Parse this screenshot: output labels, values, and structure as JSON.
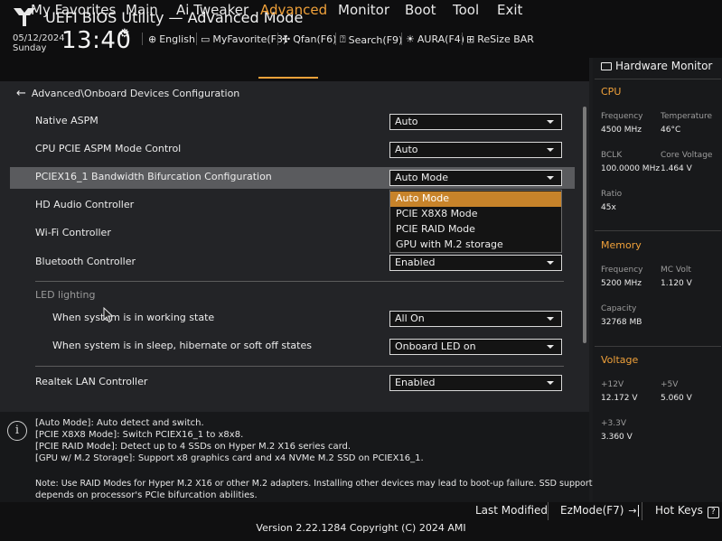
{
  "app": {
    "title": "UEFI BIOS Utility — Advanced Mode"
  },
  "clock": {
    "date": "05/12/2024",
    "day": "Sunday",
    "time": "13:40"
  },
  "toolbar": {
    "items": [
      {
        "label": "English",
        "icon": "globe-icon"
      },
      {
        "label": "MyFavorite(F3)",
        "icon": "favorite-icon"
      },
      {
        "label": "Qfan(F6)",
        "icon": "fan-icon"
      },
      {
        "label": "Search(F9)",
        "icon": "search-icon"
      },
      {
        "label": "AURA(F4)",
        "icon": "aura-icon"
      },
      {
        "label": "ReSize BAR",
        "icon": "resize-bar-icon"
      }
    ]
  },
  "menu": {
    "items": [
      "My Favorites",
      "Main",
      "Ai Tweaker",
      "Advanced",
      "Monitor",
      "Boot",
      "Tool",
      "Exit"
    ],
    "active": "Advanced"
  },
  "breadcrumb": "Advanced\\Onboard Devices Configuration",
  "settings": [
    {
      "label": "Native ASPM",
      "value": "Auto"
    },
    {
      "label": "CPU PCIE ASPM Mode Control",
      "value": "Auto"
    },
    {
      "label": "PCIEX16_1 Bandwidth Bifurcation Configuration",
      "value": "Auto Mode"
    },
    {
      "label": "HD Audio Controller",
      "value": ""
    },
    {
      "label": "Wi-Fi Controller",
      "value": ""
    },
    {
      "label": "Bluetooth Controller",
      "value": "Enabled"
    },
    {
      "label": "LED lighting",
      "value": ""
    },
    {
      "label": "When system is in working state",
      "value": "All On"
    },
    {
      "label": "When system is in sleep, hibernate or soft off states",
      "value": "Onboard LED on"
    },
    {
      "label": "Realtek LAN Controller",
      "value": "Enabled"
    }
  ],
  "dropdown": {
    "options": [
      "Auto Mode",
      "PCIE X8X8 Mode",
      "PCIE RAID Mode",
      "GPU with M.2 storage"
    ],
    "selected": "Auto Mode"
  },
  "help": {
    "lines": [
      "[Auto Mode]: Auto detect and switch.",
      "[PCIE X8X8 Mode]: Switch PCIEX16_1 to x8x8.",
      "[PCIE RAID Mode]: Detect up to 4 SSDs on Hyper M.2 X16 series card.",
      "[GPU w/ M.2 Storage]: Support x8 graphics card and x4 NVMe M.2 SSD on PCIEX16_1.",
      "Note: Use RAID Modes for Hyper M.2 X16 or other M.2 adapters. Installing other devices may lead to boot-up failure. SSD support",
      "depends on processor's PCIe bifurcation abilities."
    ]
  },
  "hardware_monitor": {
    "title": "Hardware Monitor",
    "cpu": {
      "heading": "CPU",
      "frequency_label": "Frequency",
      "frequency": "4500 MHz",
      "temperature_label": "Temperature",
      "temperature": "46°C",
      "bclk_label": "BCLK",
      "bclk": "100.0000 MHz",
      "core_voltage_label": "Core Voltage",
      "core_voltage": "1.464 V",
      "ratio_label": "Ratio",
      "ratio": "45x"
    },
    "memory": {
      "heading": "Memory",
      "frequency_label": "Frequency",
      "frequency": "5200 MHz",
      "mc_volt_label": "MC Volt",
      "mc_volt": "1.120 V",
      "capacity_label": "Capacity",
      "capacity": "32768 MB"
    },
    "voltage": {
      "heading": "Voltage",
      "v12_label": "+12V",
      "v12": "12.172 V",
      "v5_label": "+5V",
      "v5": "5.060 V",
      "v33_label": "+3.3V",
      "v33": "3.360 V"
    }
  },
  "footer": {
    "last_modified": "Last Modified",
    "ezmode": "EzMode(F7)",
    "hotkeys": "Hot Keys",
    "version": "Version 2.22.1284 Copyright (C) 2024 AMI"
  },
  "colors": {
    "accent": "#f0a13a",
    "selected_option": "#c7832a",
    "highlight_row": "#5a5b5e"
  }
}
